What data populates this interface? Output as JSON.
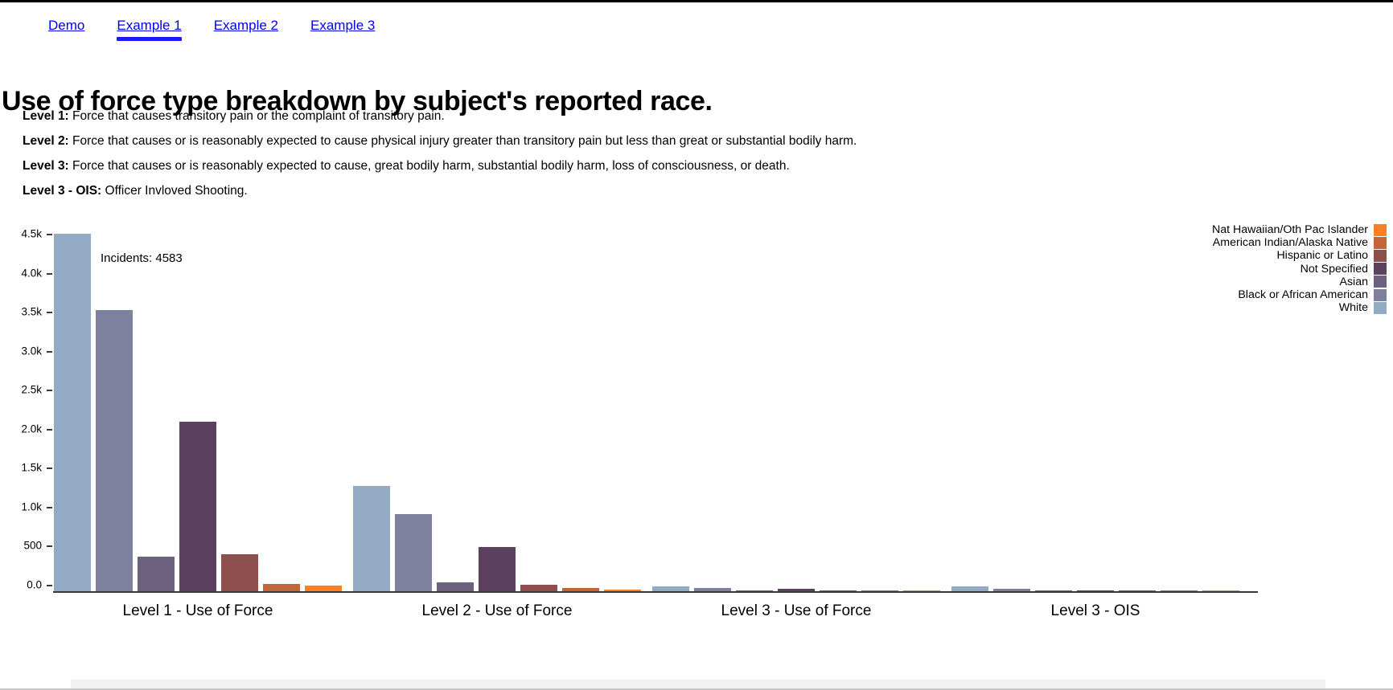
{
  "nav": {
    "items": [
      {
        "label": "Demo",
        "active": false
      },
      {
        "label": "Example 1",
        "active": true
      },
      {
        "label": "Example 2",
        "active": false
      },
      {
        "label": "Example 3",
        "active": false
      }
    ]
  },
  "page_title": "Use of force type breakdown by subject's reported race.",
  "definitions": [
    {
      "term": "Level 1:",
      "text": " Force that causes transitory pain or the complaint of transitory pain."
    },
    {
      "term": "Level 2:",
      "text": " Force that causes or is reasonably expected to cause physical injury greater than transitory pain but less than great or substantial bodily harm."
    },
    {
      "term": "Level 3:",
      "text": " Force that causes or is reasonably expected to cause, great bodily harm, substantial bodily harm, loss of consciousness, or death."
    },
    {
      "term": "Level 3 - OIS:",
      "text": " Officer Invloved Shooting."
    }
  ],
  "tooltip": {
    "text": "Incidents: 4583"
  },
  "legend": {
    "entries": [
      {
        "label": "Nat Hawaiian/Oth Pac Islander",
        "color": "#f98024"
      },
      {
        "label": "American Indian/Alaska Native",
        "color": "#c3653a"
      },
      {
        "label": "Hispanic or Latino",
        "color": "#8f4f4c"
      },
      {
        "label": "Not Specified",
        "color": "#5b4060"
      },
      {
        "label": "Asian",
        "color": "#6d6180"
      },
      {
        "label": "Black or African American",
        "color": "#7d819e"
      },
      {
        "label": "White",
        "color": "#93aac4"
      }
    ]
  },
  "chart_data": {
    "type": "bar",
    "title": "Use of force type breakdown by subject's reported race.",
    "xlabel": "",
    "ylabel": "",
    "ylim": [
      0,
      4700
    ],
    "grid": false,
    "legend_position": "top-right",
    "ytick_labels": [
      "0.0",
      "500",
      "1.0k",
      "1.5k",
      "2.0k",
      "2.5k",
      "3.0k",
      "3.5k",
      "4.0k",
      "4.5k"
    ],
    "ytick_values": [
      0,
      500,
      1000,
      1500,
      2000,
      2500,
      3000,
      3500,
      4000,
      4500
    ],
    "categories": [
      "Level 1 - Use of Force",
      "Level 2 - Use of Force",
      "Level 3 - Use of Force",
      "Level 3 - OIS"
    ],
    "series": [
      {
        "name": "White",
        "color": "#93aac4",
        "values": [
          4583,
          1355,
          60,
          58
        ]
      },
      {
        "name": "Black or African American",
        "color": "#7d819e",
        "values": [
          3610,
          990,
          38,
          30
        ]
      },
      {
        "name": "Asian",
        "color": "#6d6180",
        "values": [
          440,
          110,
          5,
          3
        ]
      },
      {
        "name": "Not Specified",
        "color": "#5b4060",
        "values": [
          2180,
          565,
          35,
          8
        ]
      },
      {
        "name": "Hispanic or Latino",
        "color": "#8f4f4c",
        "values": [
          470,
          85,
          4,
          2
        ]
      },
      {
        "name": "American Indian/Alaska Native",
        "color": "#c3653a",
        "values": [
          95,
          38,
          2,
          1
        ]
      },
      {
        "name": "Nat Hawaiian/Oth Pac Islander",
        "color": "#f98024",
        "values": [
          70,
          25,
          2,
          1
        ]
      }
    ]
  }
}
